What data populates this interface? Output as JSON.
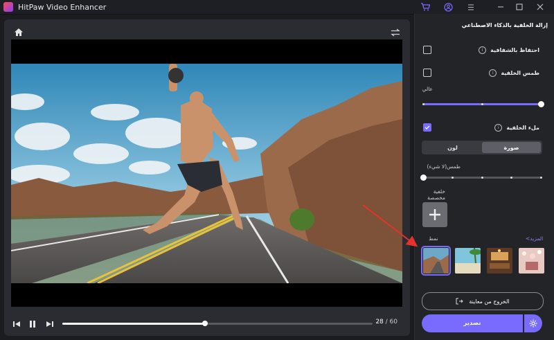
{
  "app": {
    "title": "HitPaw Video Enhancer"
  },
  "titlebar": {
    "icons": [
      "cart-icon",
      "account-icon",
      "menu-icon",
      "minimize-icon",
      "maximize-icon",
      "close-icon"
    ]
  },
  "player": {
    "current_time": "28",
    "separator": " / ",
    "total_time": "60",
    "progress": 0.46
  },
  "panel": {
    "title": "إزالة الخلفية بالذكاء الاصطناعي",
    "keep_transparent": {
      "label": "احتفاظ بالشفافية",
      "checked": false
    },
    "blur_background": {
      "label": "طمس الخلفية",
      "checked": false
    },
    "blur_level_label": "عالي",
    "blur_level": 1.0,
    "fill_background": {
      "label": "ملء الخلفية",
      "checked": true
    },
    "tabs": {
      "image": "صورة",
      "color": "لون",
      "active": "image"
    },
    "blur_none_label": "طمس(لا شيء)",
    "blur_none_level": 0.0,
    "custom_bg_label": "خلفية مخصصة",
    "more_link": "المزيد>",
    "style_label": "نمط",
    "styles": [
      "desert-road",
      "beach",
      "interior-room",
      "cafe-lights"
    ],
    "selected_style": 0,
    "exit_preview": "الخروج من معاينة",
    "export": "تصدير"
  },
  "colors": {
    "accent": "#7a6bff",
    "panel_bg": "#232428",
    "player_bg": "#2b2c31"
  }
}
